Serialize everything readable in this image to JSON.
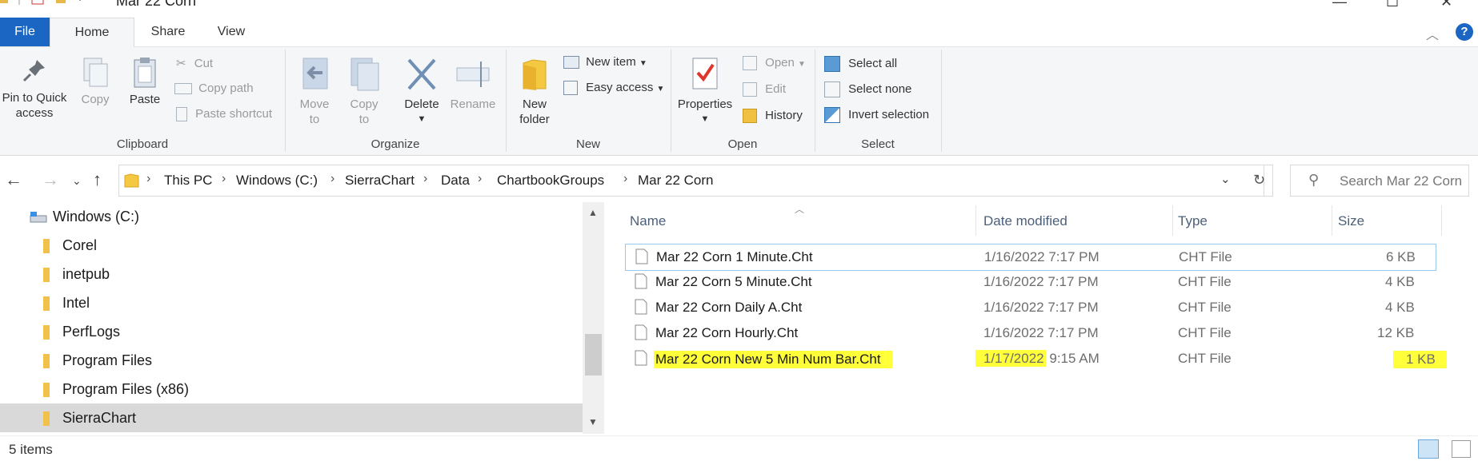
{
  "window": {
    "title": "Mar 22 Corn"
  },
  "tabs": {
    "file": "File",
    "home": "Home",
    "share": "Share",
    "view": "View",
    "help": "?"
  },
  "ribbon": {
    "clipboard": {
      "label": "Clipboard",
      "pin_line1": "Pin to Quick",
      "pin_line2": "access",
      "copy": "Copy",
      "paste": "Paste",
      "cut": "Cut",
      "copy_path": "Copy path",
      "paste_shortcut": "Paste shortcut"
    },
    "organize": {
      "label": "Organize",
      "move_line1": "Move",
      "move_line2": "to",
      "copy_line1": "Copy",
      "copy_line2": "to",
      "delete": "Delete",
      "rename": "Rename"
    },
    "new": {
      "label": "New",
      "folder_line1": "New",
      "folder_line2": "folder",
      "new_item": "New item",
      "easy_access": "Easy access"
    },
    "open": {
      "label": "Open",
      "properties": "Properties",
      "open": "Open",
      "edit": "Edit",
      "history": "History"
    },
    "select": {
      "label": "Select",
      "select_all": "Select all",
      "select_none": "Select none",
      "invert": "Invert selection"
    }
  },
  "address": {
    "crumbs": [
      "This PC",
      "Windows (C:)",
      "SierraChart",
      "Data",
      "ChartbookGroups",
      "Mar 22 Corn"
    ],
    "search_placeholder": "Search Mar 22 Corn"
  },
  "tree": {
    "items": [
      {
        "label": "Windows (C:)",
        "type": "drive"
      },
      {
        "label": "Corel",
        "type": "folder"
      },
      {
        "label": "inetpub",
        "type": "folder"
      },
      {
        "label": "Intel",
        "type": "folder"
      },
      {
        "label": "PerfLogs",
        "type": "folder"
      },
      {
        "label": "Program Files",
        "type": "folder"
      },
      {
        "label": "Program Files (x86)",
        "type": "folder"
      },
      {
        "label": "SierraChart",
        "type": "folder",
        "selected": true
      }
    ]
  },
  "columns": {
    "name": "Name",
    "date": "Date modified",
    "type": "Type",
    "size": "Size"
  },
  "files": [
    {
      "name": "Mar 22 Corn 1 Minute.Cht",
      "date": "1/16/2022 7:17 PM",
      "type": "CHT File",
      "size": "6 KB"
    },
    {
      "name": "Mar 22 Corn 5 Minute.Cht",
      "date": "1/16/2022 7:17 PM",
      "type": "CHT File",
      "size": "4 KB"
    },
    {
      "name": "Mar 22 Corn Daily A.Cht",
      "date": "1/16/2022 7:17 PM",
      "type": "CHT File",
      "size": "4 KB"
    },
    {
      "name": "Mar 22 Corn Hourly.Cht",
      "date": "1/16/2022 7:17 PM",
      "type": "CHT File",
      "size": "12 KB"
    },
    {
      "name": "Mar 22 Corn New 5 Min Num Bar.Cht",
      "date_day": "1/17/2022",
      "date_time": "9:15 AM",
      "type": "CHT File",
      "size": "1 KB"
    }
  ],
  "status": {
    "count": "5 items"
  },
  "colors": {
    "accent": "#1a66c2",
    "highlight": "#ffff3a",
    "selected_row": "#d9d9d9"
  }
}
